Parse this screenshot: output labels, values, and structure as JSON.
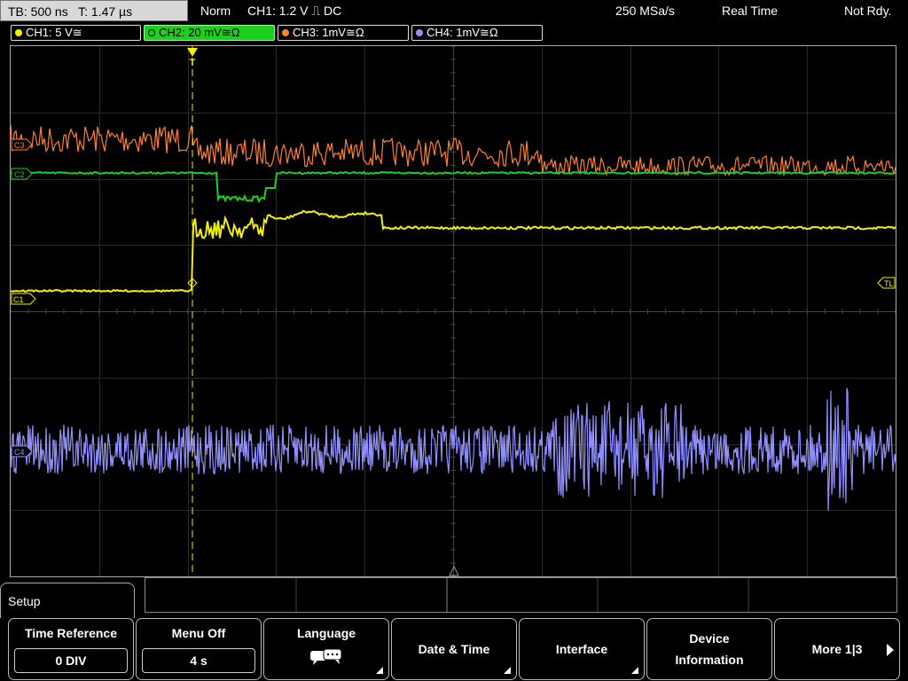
{
  "header": {
    "timebase": "TB: 500 ns",
    "trigger_time": "T: 1.47 µs",
    "mode": "Norm",
    "trigger": "CH1: 1.2 V ⎍ DC",
    "sample_rate": "250 MSa/s",
    "acq_mode": "Real Time",
    "status": "Not Rdy."
  },
  "channels": [
    {
      "label": "CH1: 5 V≅",
      "color": "#f4f000"
    },
    {
      "label": "CH2: 20 mV≅Ω",
      "color": "#1ed01e"
    },
    {
      "label": "CH3: 1mV≅Ω",
      "color": "#ff8030"
    },
    {
      "label": "CH4: 1mV≅Ω",
      "color": "#9090ff"
    }
  ],
  "markers": {
    "ch1": "C1",
    "ch2": "C2",
    "ch3": "C3",
    "ch4": "C4",
    "trigger_level": "TL",
    "trigger_pos": "T"
  },
  "menu": {
    "title": "Setup",
    "softkeys": [
      {
        "label": "Time Reference",
        "value": "0 DIV"
      },
      {
        "label": "Menu Off",
        "value": "4 s"
      },
      {
        "label": "Language",
        "icon": "speech-bubble-icon"
      },
      {
        "label": "Date & Time"
      },
      {
        "label": "Interface"
      },
      {
        "label": "Device",
        "label2": "Information"
      },
      {
        "label": "More 1|3"
      }
    ]
  }
}
